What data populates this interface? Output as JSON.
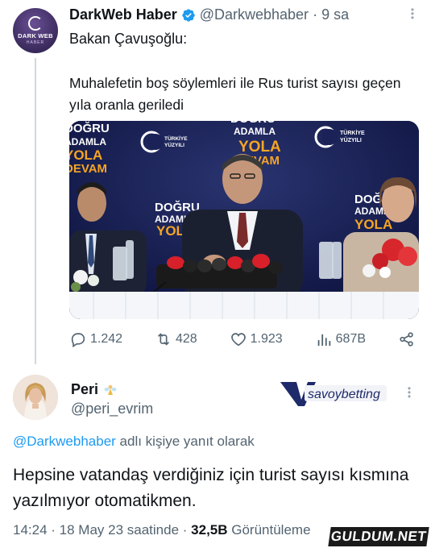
{
  "tweet": {
    "avatar_text": "DARK WEB",
    "avatar_sub": "HABER",
    "author_name": "DarkWeb Haber",
    "handle": "@Darkwebhaber",
    "separator": "·",
    "time": "9 sa",
    "line1": "Bakan Çavuşoğlu:",
    "line2": "Muhalefetin boş söylemleri ile Rus turist sayısı geçen yıla oranla geriledi",
    "image_banners": {
      "dogru": "DOĞRU",
      "adamla": "ADAMLA",
      "yola": "YOLA",
      "devam": "DEVAM",
      "turkiye": "TÜRKİYE",
      "yuzyili": "YÜZYILI"
    },
    "stats": {
      "replies": "1.242",
      "retweets": "428",
      "likes": "1.923",
      "views": "687B"
    }
  },
  "reply": {
    "author_name": "Peri",
    "handle": "@peri_evrim",
    "ad_brand": "savoybetting",
    "replying_prefix": "@Darkwebhaber",
    "replying_suffix": " adlı kişiye yanıt olarak",
    "text": "Hepsine  vatandaş verdiğiniz  için turist sayısı kısmına yazılmıyor otomatikmen.",
    "time": "14:24",
    "date_dot": " · ",
    "date": "18 May 23 saatinde",
    "views_dot": " · ",
    "views": "32,5B",
    "views_label": " Görüntüleme"
  },
  "watermark": "GULDUM.NET",
  "colors": {
    "accent": "#1d9bf0",
    "muted": "#536471",
    "text": "#0f1419",
    "banner_orange": "#f5a524",
    "banner_navy": "#141b4d"
  }
}
